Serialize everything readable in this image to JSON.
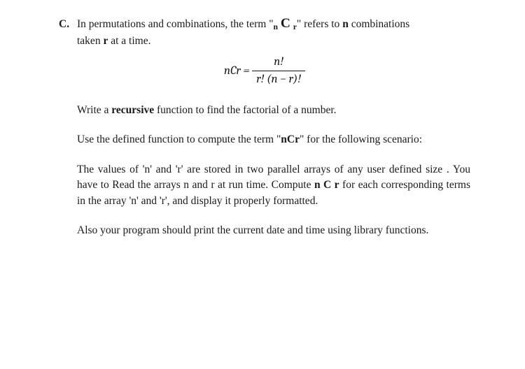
{
  "item_marker": "C.",
  "line1_part1": "In permutations and combinations, the term \"",
  "ncr_n": "n",
  "ncr_C": "C",
  "ncr_r": "r",
  "line1_part2": "\" refers to ",
  "line1_bold_n": "n",
  "line1_part3": " combinations",
  "line2_part1": "taken ",
  "line2_bold_r": "r",
  "line2_part2": " at a time.",
  "formula_lhs": "nCr =",
  "formula_num": "n!",
  "formula_den": "r! (n − r)!",
  "para2_a": "Write a ",
  "para2_bold": "recursive",
  "para2_b": " function to find the factorial of a number.",
  "para3_a": "Use the defined function to compute the term  \"",
  "para3_bold": "nCr",
  "para3_b": "\"  for the following scenario:",
  "para4_a": "The values of 'n' and 'r' are stored in two parallel   arrays of any user defined size . You have to Read the arrays n and r at run time.  Compute   ",
  "para4_bold": "n C r",
  "para4_b": " for each corresponding terms in the array 'n' and 'r', and display it properly formatted.",
  "para5": "Also your program should print the current date and time using library functions."
}
